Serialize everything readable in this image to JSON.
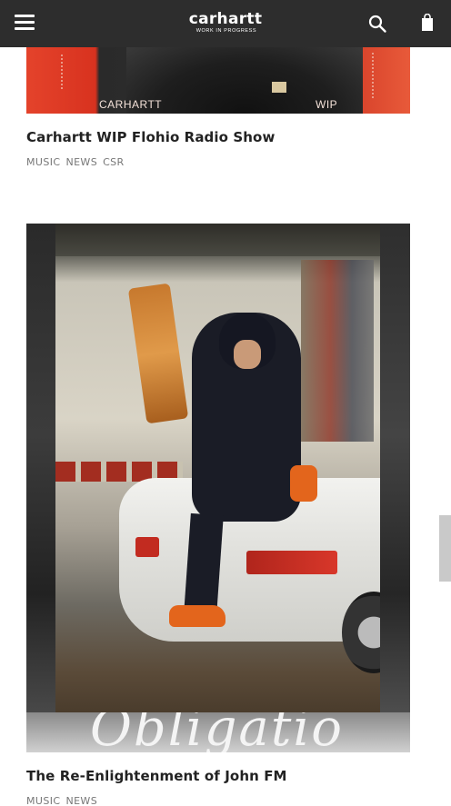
{
  "header": {
    "logo_word": "carhartt",
    "logo_sub": "WORK IN PROGRESS",
    "menu_icon": "hamburger-menu-icon",
    "search_icon": "search-icon",
    "bag_icon": "shopping-bag-icon",
    "background_color": "#2d2d2d"
  },
  "articles": [
    {
      "image_label_left": "CARHARTT",
      "image_label_right": "WIP",
      "title": "Carhartt WIP Flohio Radio Show",
      "tags": [
        "MUSIC",
        "NEWS",
        "CSR"
      ]
    },
    {
      "image_script_text": "Obligatio",
      "title": "The Re-Enlightenment of John FM",
      "tags": [
        "MUSIC",
        "NEWS"
      ]
    }
  ]
}
